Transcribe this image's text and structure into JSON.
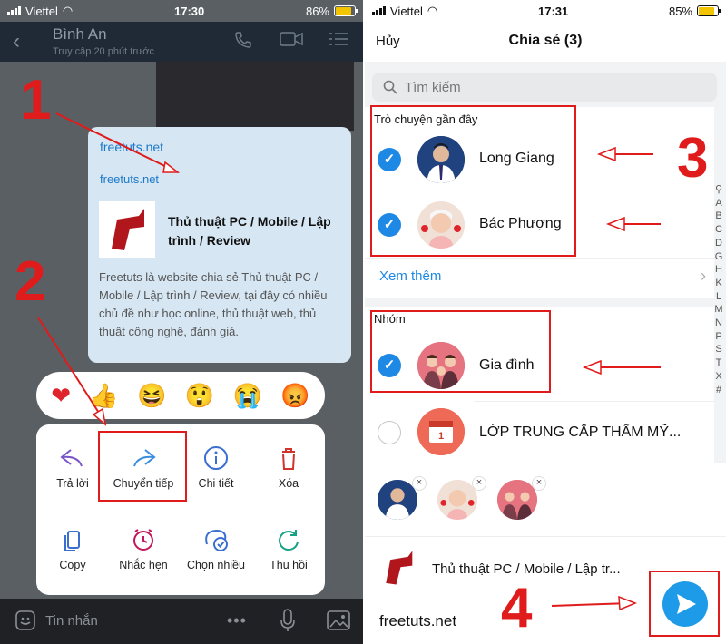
{
  "left": {
    "status": {
      "carrier": "Viettel",
      "time": "17:30",
      "battery": "86%",
      "battery_level": 0.86
    },
    "header": {
      "name": "Bình An",
      "subtitle": "Truy cập 20 phút trước"
    },
    "card": {
      "site_top": "freetuts.net",
      "site": "freetuts.net",
      "title": "Thủ thuật PC / Mobile / Lập trình / Review",
      "description": "Freetuts là website chia sẻ Thủ thuật PC / Mobile / Lập trình / Review, tại đây có nhiều chủ đề như học online, thủ thuật web, thủ thuật công nghệ, đánh giá."
    },
    "reactions": [
      "heart",
      "thumbs-up",
      "laughing",
      "surprised",
      "crying",
      "angry"
    ],
    "menu": [
      {
        "label": "Trả lời",
        "icon": "reply-icon"
      },
      {
        "label": "Chuyển tiếp",
        "icon": "forward-icon"
      },
      {
        "label": "Chi tiết",
        "icon": "info-icon"
      },
      {
        "label": "Xóa",
        "icon": "trash-icon"
      },
      {
        "label": "Copy",
        "icon": "copy-icon"
      },
      {
        "label": "Nhắc hẹn",
        "icon": "alarm-icon"
      },
      {
        "label": "Chọn nhiều",
        "icon": "multi-select-icon"
      },
      {
        "label": "Thu hồi",
        "icon": "recall-icon"
      }
    ],
    "input_placeholder": "Tin nhắn",
    "step_numbers": [
      "1",
      "2"
    ]
  },
  "right": {
    "status": {
      "carrier": "Viettel",
      "time": "17:31",
      "battery": "85%",
      "battery_level": 0.85
    },
    "nav": {
      "cancel": "Hủy",
      "title": "Chia sẻ (3)"
    },
    "search_placeholder": "Tìm kiếm",
    "recent": {
      "heading": "Trò chuyện gần đây",
      "items": [
        {
          "name": "Long Giang",
          "checked": true
        },
        {
          "name": "Bác Phượng",
          "checked": true
        }
      ],
      "more": "Xem thêm"
    },
    "groups": {
      "heading": "Nhóm",
      "items": [
        {
          "name": "Gia đình",
          "checked": true
        },
        {
          "name": "LỚP TRUNG CẤP THẨM MỸ...",
          "checked": false
        }
      ]
    },
    "alphabet": [
      "A",
      "B",
      "C",
      "D",
      "G",
      "H",
      "K",
      "L",
      "M",
      "N",
      "P",
      "S",
      "T",
      "X",
      "#"
    ],
    "share": {
      "title": "Thủ thuật PC / Mobile / Lập tr...",
      "site": "freetuts.net"
    },
    "step_numbers": [
      "3",
      "4"
    ]
  },
  "colors": {
    "accent": "#1e88e5",
    "annotation": "#e01b1b"
  }
}
